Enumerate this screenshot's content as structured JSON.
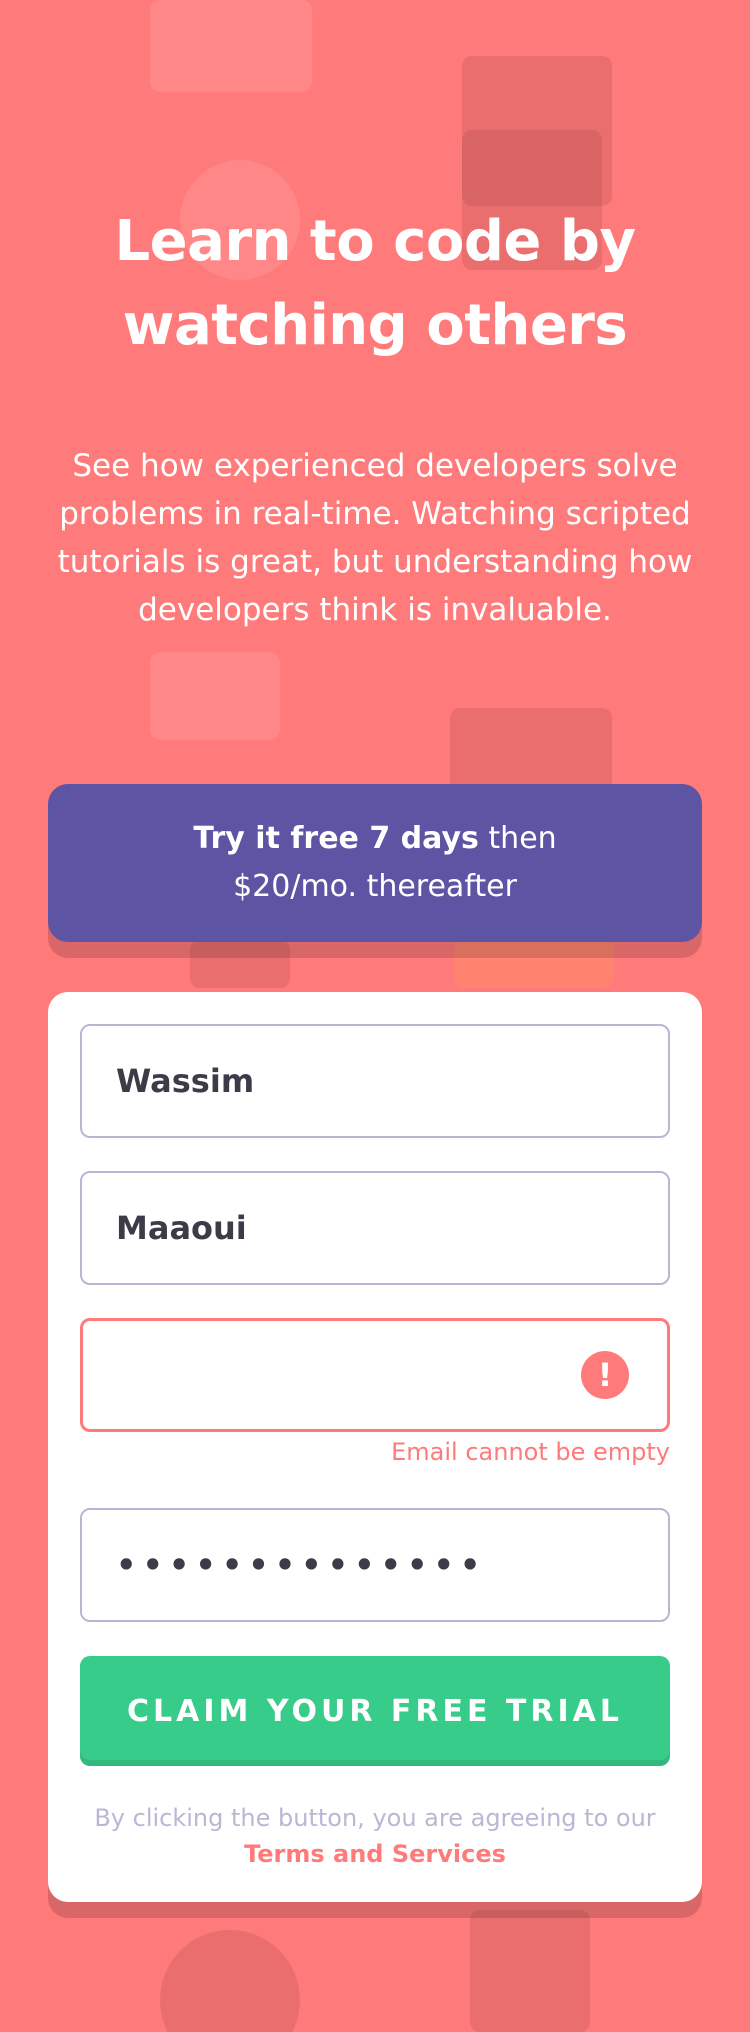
{
  "hero": {
    "title": "Learn to code by watching others",
    "description": "See how experienced developers solve problems in real-time. Watching scripted tutorials is great, but understanding how developers think is invaluable."
  },
  "promo": {
    "bold": "Try it free 7 days",
    "rest_line1": " then",
    "rest_line2": "$20/mo. thereafter"
  },
  "form": {
    "first_name_value": "Wassim",
    "last_name_value": "Maaoui",
    "email_value": "",
    "email_error": "Email cannot be empty",
    "error_icon_glyph": "!",
    "password_mask": "••••••••••••••",
    "cta_label": "Claim your free trial",
    "legal_prefix": "By clicking the button, you are agreeing to our ",
    "legal_link": "Terms and Services"
  },
  "colors": {
    "background": "#FF7A7A",
    "promo": "#5E54A4",
    "cta": "#38CC8B",
    "error": "#FF7A7A"
  }
}
